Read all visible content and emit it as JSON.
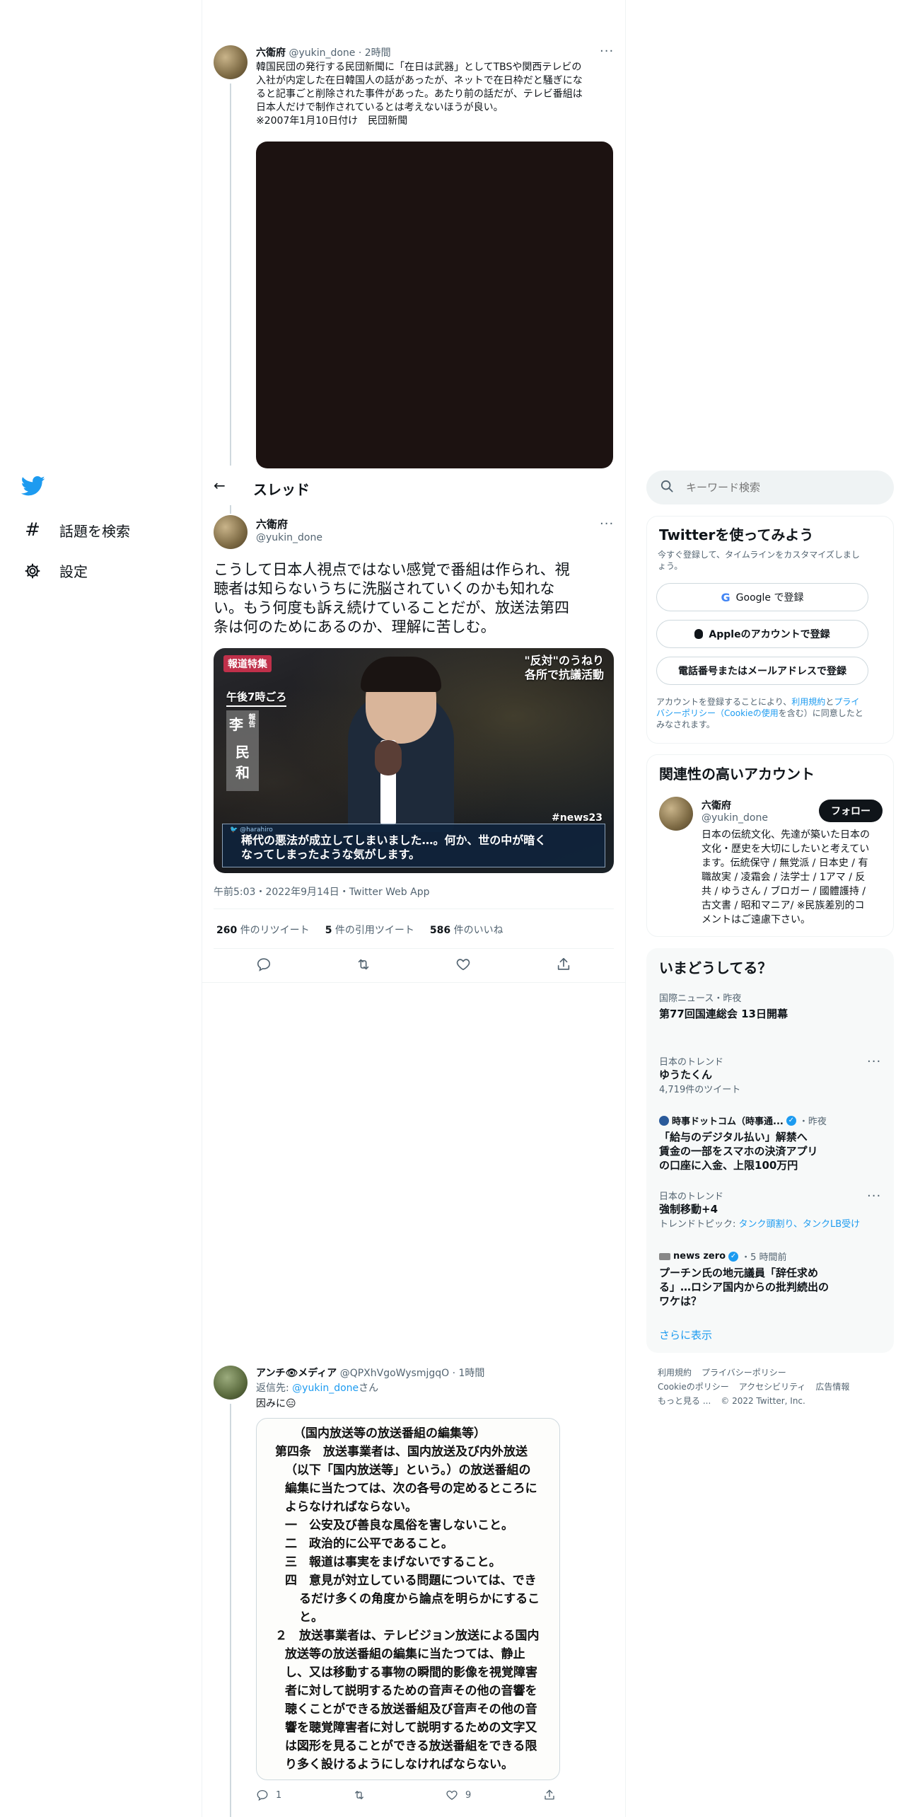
{
  "left_nav": {
    "logo": "twitter-bird-icon",
    "explore": "話題を検索",
    "settings": "設定"
  },
  "top_tweet": {
    "name": "六衛府",
    "handle": "@yukin_done",
    "time": "· 2時間",
    "text_lines": [
      "韓国民団の発行する民団新聞に「在日は武器」としてTBSや関西テレビの",
      "入社が内定した在日韓国人の話があったが、ネットで在日枠だと騒ぎにな",
      "ると記事ごと削除された事件があった。あたり前の話だが、テレビ番組は",
      "日本人だけで制作されているとは考えないほうが良い。",
      "※2007年1月10日付け　民団新聞"
    ]
  },
  "header": {
    "back": "←",
    "title": "スレッド"
  },
  "main_tweet": {
    "name": "六衛府",
    "handle": "@yukin_done",
    "text_lines": [
      "こうして日本人視点ではない感覚で番組は作られ、視",
      "聴者は知らないうちに洗脳されていくのかも知れな",
      "い。もう何度も訴え続けていることだが、放送法第四",
      "条は何のためにあるのか、理解に苦しむ。"
    ],
    "image": {
      "logo": "報道特集",
      "top_right_1": "\"反対\"のうねり",
      "top_right_2": "各所で抗議活動",
      "time_label": "午後7時ごろ",
      "reporter_role": "報告",
      "reporter_name": [
        "李",
        "民",
        "和"
      ],
      "hashtag": "#news23",
      "caption_user": "@harahiro",
      "caption_1": "稀代の悪法が成立してしまいました…。何か、世の中が暗く",
      "caption_2": "なってしまったような気がします。"
    },
    "meta": "午前5:03・2022年9月14日・Twitter Web App",
    "retweets_count": "260",
    "retweets_label": "件のリツイート",
    "quotes_count": "5",
    "quotes_label": "件の引用ツイート",
    "likes_count": "586",
    "likes_label": "件のいいね"
  },
  "reply_tweet": {
    "name": "アンチ👁メディア",
    "handle": "@QPXhVgoWysmjgqO",
    "time": "· 1時間",
    "reply_prefix": "返信先: ",
    "reply_to": "@yukin_done",
    "reply_suffix": "さん",
    "text": "因みに😑",
    "doc_lines": [
      "（国内放送等の放送番組の編集等）",
      "第四条　放送事業者は、国内放送及び内外放送",
      "（以下「国内放送等」という。）の放送番組の",
      "編集に当たつては、次の各号の定めるところに",
      "よらなければならない。",
      "一　公安及び善良な風俗を害しないこと。",
      "二　政治的に公平であること。",
      "三　報道は事実をまげないですること。",
      "四　意見が対立している問題については、でき",
      "るだけ多くの角度から論点を明らかにするこ",
      "と。",
      "２　放送事業者は、テレビジョン放送による国内",
      "放送等の放送番組の編集に当たつては、静止",
      "し、又は移動する事物の瞬間的影像を視覚障害",
      "者に対して説明するための音声その他の音響を",
      "聴くことができる放送番組及び音声その他の音",
      "響を聴覚障害者に対して説明するための文字又",
      "は図形を見ることができる放送番組をできる限",
      "り多く設けるようにしなければならない。"
    ],
    "reply_count": "1",
    "like_count": "9"
  },
  "search": {
    "placeholder": "キーワード検索"
  },
  "signup": {
    "title": "Twitterを使ってみよう",
    "subtitle_1": "今すぐ登録して、タイムラインをカスタマイズしまし",
    "subtitle_2": "ょう。",
    "google_btn": "Google で登録",
    "apple_btn": "Appleのアカウントで登録",
    "phone_btn": "電話番号またはメールアドレスで登録",
    "terms_1": "アカウントを登録することにより、",
    "terms_link_1": "利用規約",
    "terms_2": "と",
    "terms_link_2": "プライ",
    "terms_link_3": "バシーポリシー（Cookieの使用",
    "terms_3": "を含む）に同意したと",
    "terms_4": "みなされます。"
  },
  "relevant": {
    "title": "関連性の高いアカウント",
    "name": "六衛府",
    "handle": "@yukin_done",
    "follow": "フォロー",
    "bio_lines": [
      "日本の伝統文化、先達が築いた日本の",
      "文化・歴史を大切にしたいと考えてい",
      "ます。伝統保守 / 無党派 / 日本史 / 有",
      "職故実 / 凌霜会 / 法学士 / 1アマ / 反",
      "共 / ゆうさん / ブロガー / 國體護持 /",
      "古文書 / 昭和マニア/ ※民族差別的コ",
      "メントはご遠慮下さい。"
    ]
  },
  "trends": {
    "title": "いまどうしてる？",
    "items": [
      {
        "kicker": "国際ニュース・昨夜",
        "title": "第77回国連総会 13日開幕"
      },
      {
        "kicker": "日本のトレンド",
        "title": "ゆうたくん",
        "sub": "4,719件のツイート"
      },
      {
        "kicker_name": "時事ドットコム（時事通...",
        "kicker_time": "・昨夜",
        "title_lines": [
          "「給与のデジタル払い」解禁へ",
          "賃金の一部をスマホの決済アプリ",
          "の口座に入金、上限100万円"
        ]
      },
      {
        "kicker": "日本のトレンド",
        "title": "強制移動+4",
        "sub_prefix": "トレンドトピック: ",
        "sub_links": "タンク頭割り、タンクLB受け"
      },
      {
        "kicker_name": "news zero",
        "kicker_time": "・5 時間前",
        "title_lines": [
          "プーチン氏の地元議員「辞任求め",
          "る」…ロシア国内からの批判続出の",
          "ワケは？"
        ]
      }
    ],
    "show_more": "さらに表示"
  },
  "footer": {
    "line1": [
      "利用規約",
      "プライバシーポリシー"
    ],
    "line2": [
      "Cookieのポリシー",
      "アクセシビリティ",
      "広告情報"
    ],
    "line3": [
      "もっと見る ...",
      "© 2022 Twitter, Inc."
    ]
  },
  "colors": {
    "accent": "#1d9bf0",
    "text": "#0f1419",
    "muted": "#536471",
    "border": "#eff3f4",
    "panel": "#f7f9f9"
  }
}
